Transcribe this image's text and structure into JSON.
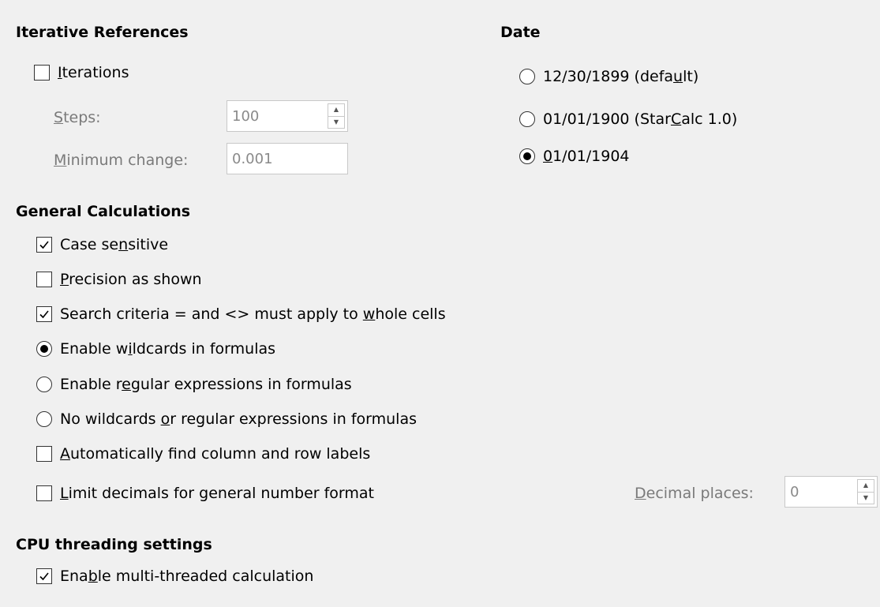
{
  "iterative": {
    "heading": "Iterative References",
    "iterations": {
      "label_u": "I",
      "label_rest": "terations",
      "checked": false
    },
    "steps": {
      "label_u": "S",
      "label_rest": "teps:",
      "value": "100"
    },
    "min_change": {
      "label_u": "M",
      "label_rest": "inimum change:",
      "value": "0.001"
    }
  },
  "general": {
    "heading": "General Calculations",
    "case_sensitive": {
      "pre": "Case se",
      "u": "n",
      "post": "sitive",
      "checked": true
    },
    "precision": {
      "pre": "",
      "u": "P",
      "post": "recision as shown",
      "checked": false
    },
    "search_criteria": {
      "pre": "Search criteria = and <> must apply to ",
      "u": "w",
      "post": "hole cells",
      "checked": true
    },
    "wildcards": {
      "pre": "Enable w",
      "u": "i",
      "post": "ldcards in formulas",
      "selected": true
    },
    "regex": {
      "pre": "Enable r",
      "u": "e",
      "post": "gular expressions in formulas",
      "selected": false
    },
    "no_wildcards": {
      "pre": "No wildcards ",
      "u": "o",
      "post": "r regular expressions in formulas",
      "selected": false
    },
    "auto_labels": {
      "pre": "",
      "u": "A",
      "post": "utomatically find column and row labels",
      "checked": false
    },
    "limit_decimals": {
      "pre": "",
      "u": "L",
      "post": "imit decimals for general number format",
      "checked": false
    },
    "decimal_places": {
      "label_u": "D",
      "label_rest": "ecimal places:",
      "value": "0"
    }
  },
  "date": {
    "heading": "Date",
    "opt1": {
      "pre": "12/30/1899 (defa",
      "u": "u",
      "post": "lt)",
      "selected": false
    },
    "opt2": {
      "pre": "01/01/1900 (Star",
      "u": "C",
      "post": "alc 1.0)",
      "selected": false
    },
    "opt3": {
      "pre": "",
      "u": "0",
      "post": "1/01/1904",
      "selected": true
    }
  },
  "cpu": {
    "heading": "CPU threading settings",
    "multithread": {
      "pre": "Ena",
      "u": "b",
      "post": "le multi-threaded calculation",
      "checked": true
    }
  }
}
